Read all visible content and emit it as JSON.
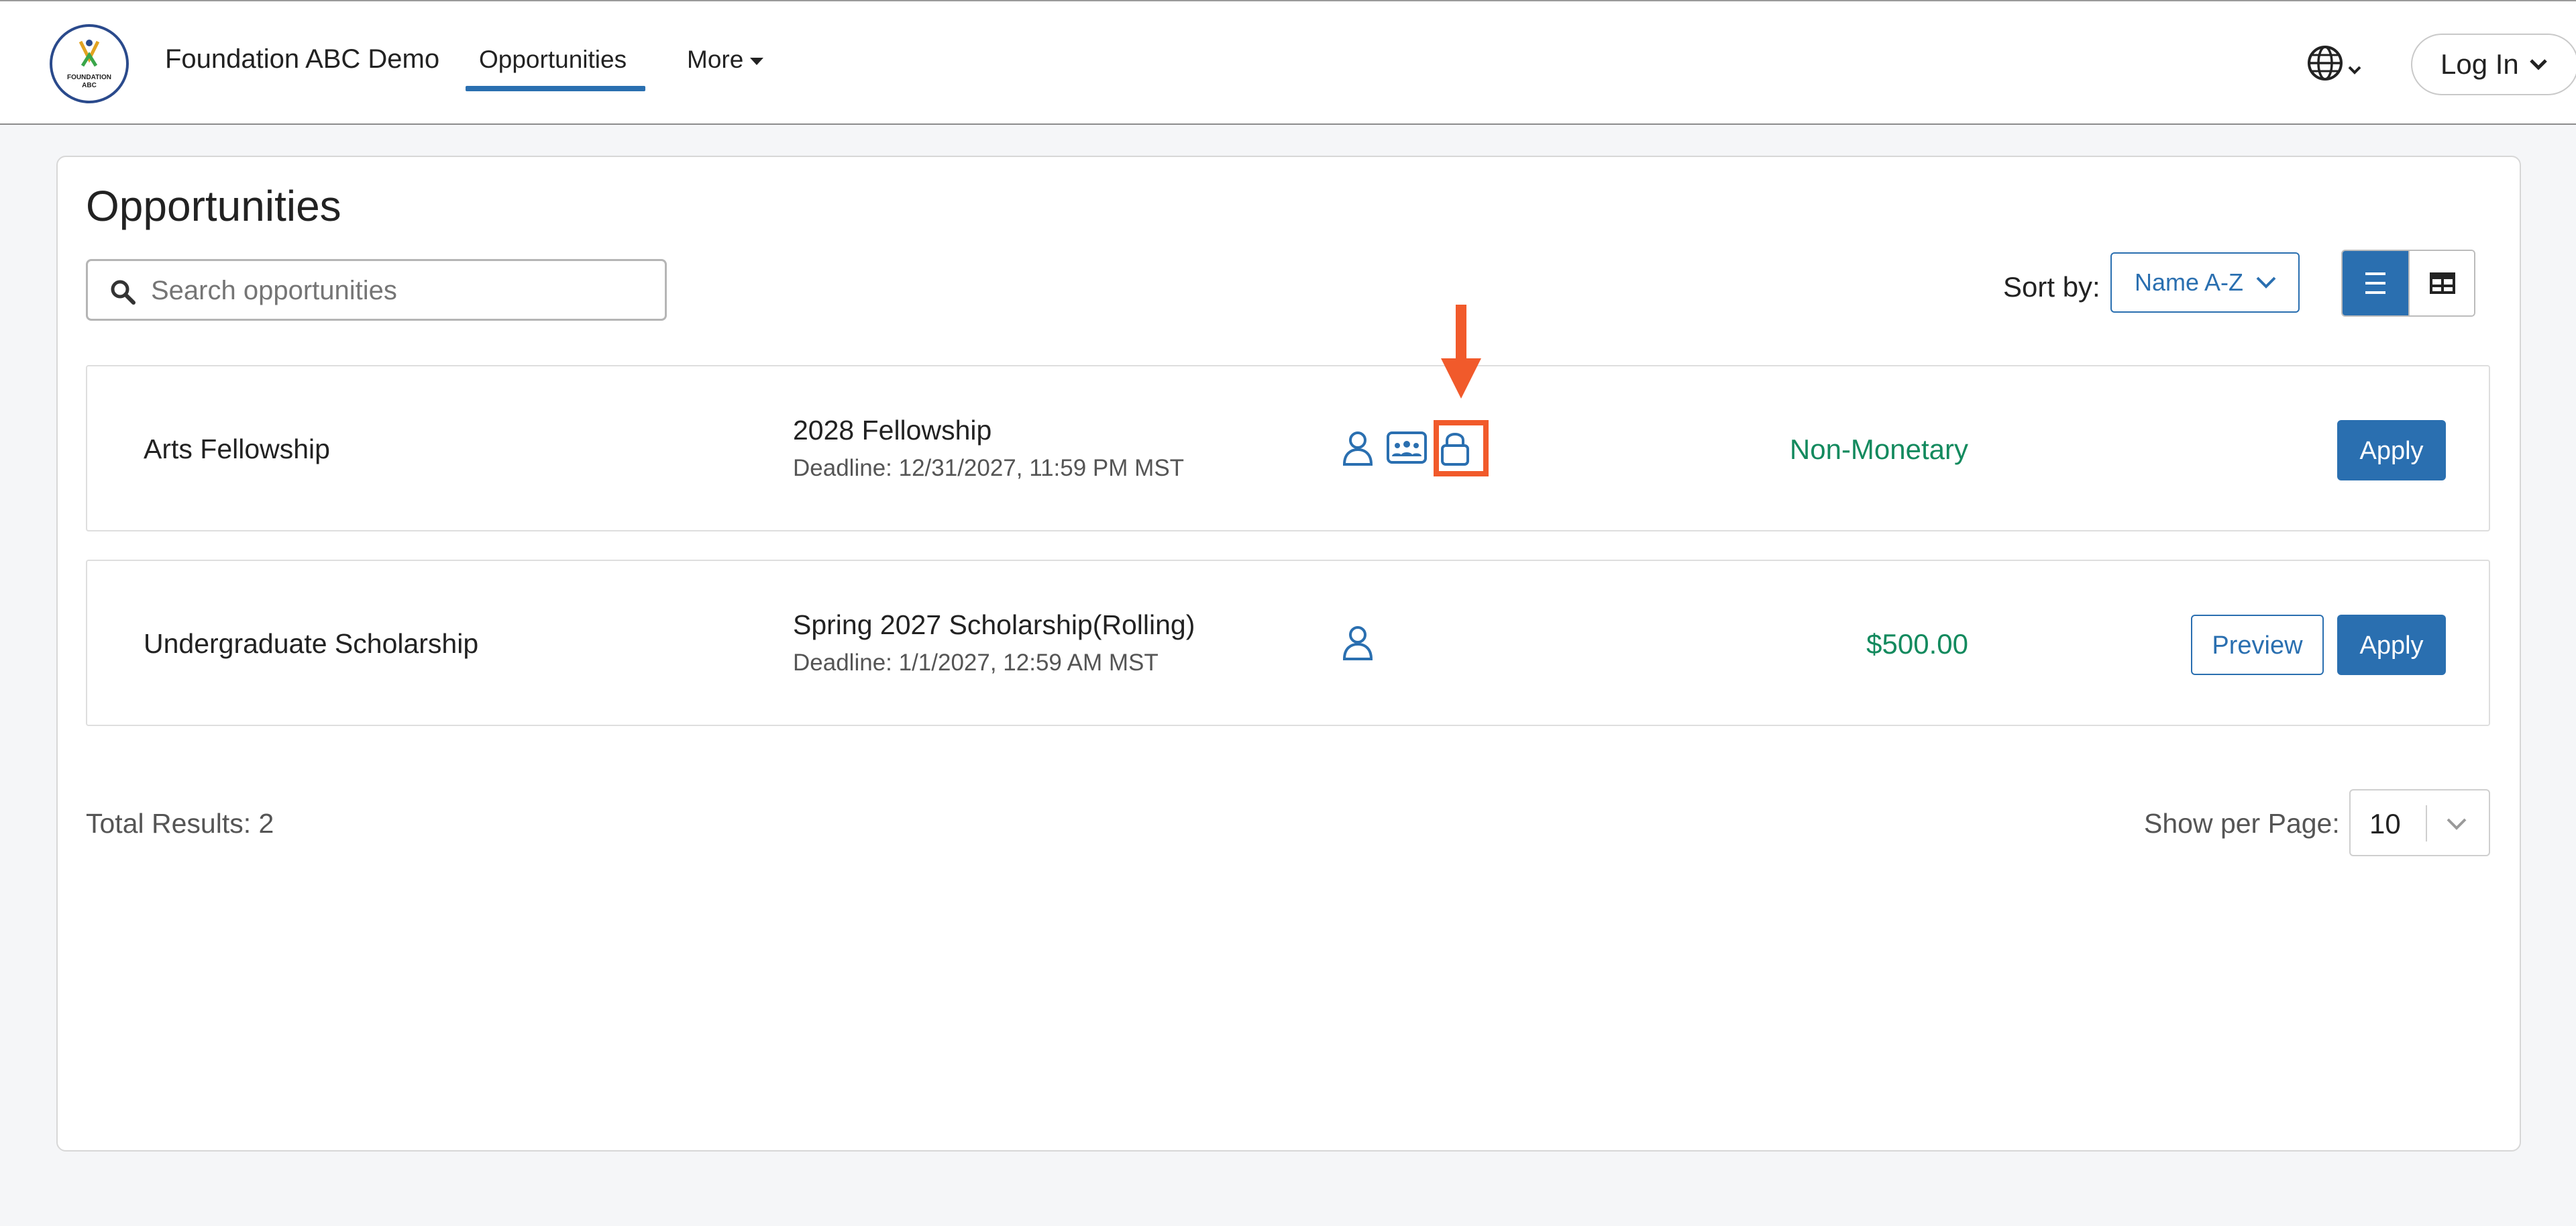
{
  "header": {
    "brand": "Foundation ABC Demo",
    "nav": [
      {
        "label": "Opportunities",
        "active": true
      },
      {
        "label": "More"
      }
    ],
    "logo_text": "FOUNDATION ABC",
    "language_icon": "globe-icon",
    "login_label": "Log In"
  },
  "main": {
    "title": "Opportunities",
    "search": {
      "placeholder": "Search opportunities",
      "value": ""
    },
    "sort": {
      "label": "Sort by:",
      "selected": "Name A-Z"
    },
    "view_modes": [
      "list-view",
      "table-view"
    ],
    "active_view": "list-view",
    "rows": [
      {
        "name": "Arts Fellowship",
        "cycle": "2028 Fellowship",
        "deadline": "Deadline: 12/31/2027, 11:59 PM MST",
        "icons": [
          "person-icon",
          "group-id-icon",
          "lock-icon"
        ],
        "amount": "Non-Monetary",
        "buttons": [
          "Apply"
        ]
      },
      {
        "name": "Undergraduate Scholarship",
        "cycle": "Spring 2027 Scholarship(Rolling)",
        "deadline": "Deadline: 1/1/2027, 12:59 AM MST",
        "icons": [
          "person-icon"
        ],
        "amount": "$500.00",
        "buttons": [
          "Preview",
          "Apply"
        ]
      }
    ],
    "total": "Total Results: 2",
    "per_page_label": "Show per Page:",
    "per_page_value": "10"
  },
  "annotation": {
    "color": "#f15a2b",
    "target": "lock-icon"
  },
  "colors": {
    "primary": "#2a6fb0",
    "amount_green": "#138a5e",
    "annotation": "#f15a2b"
  }
}
